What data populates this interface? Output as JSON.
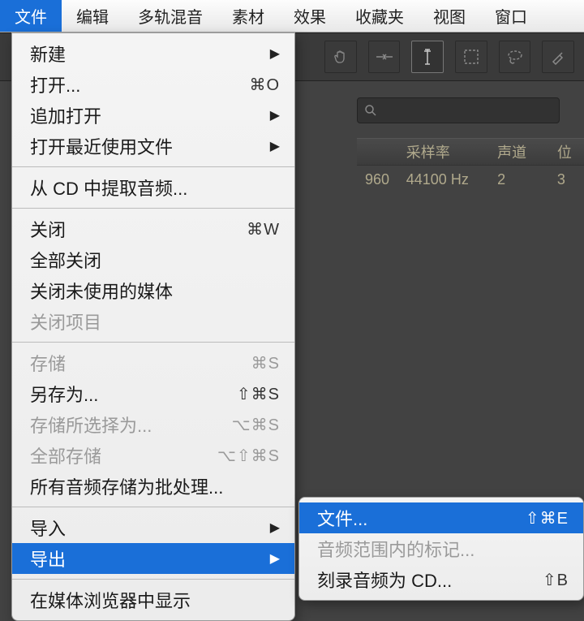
{
  "menubar": {
    "items": [
      {
        "label": "文件",
        "selected": true
      },
      {
        "label": "编辑"
      },
      {
        "label": "多轨混音"
      },
      {
        "label": "素材"
      },
      {
        "label": "效果"
      },
      {
        "label": "收藏夹"
      },
      {
        "label": "视图"
      },
      {
        "label": "窗口"
      }
    ]
  },
  "file_menu": {
    "groups": [
      [
        {
          "label": "新建",
          "submenu": true
        },
        {
          "label": "打开...",
          "shortcut": "⌘O"
        },
        {
          "label": "追加打开",
          "submenu": true
        },
        {
          "label": "打开最近使用文件",
          "submenu": true
        }
      ],
      [
        {
          "label": "从 CD 中提取音频..."
        }
      ],
      [
        {
          "label": "关闭",
          "shortcut": "⌘W"
        },
        {
          "label": "全部关闭"
        },
        {
          "label": "关闭未使用的媒体"
        },
        {
          "label": "关闭项目",
          "disabled": true
        }
      ],
      [
        {
          "label": "存储",
          "shortcut": "⌘S",
          "disabled": true
        },
        {
          "label": "另存为...",
          "shortcut": "⇧⌘S"
        },
        {
          "label": "存储所选择为...",
          "shortcut": "⌥⌘S",
          "disabled": true
        },
        {
          "label": "全部存储",
          "shortcut": "⌥⇧⌘S",
          "disabled": true
        },
        {
          "label": "所有音频存储为批处理..."
        }
      ],
      [
        {
          "label": "导入",
          "submenu": true
        },
        {
          "label": "导出",
          "submenu": true,
          "highlight": true
        }
      ],
      [
        {
          "label": "在媒体浏览器中显示"
        }
      ]
    ]
  },
  "export_submenu": {
    "items": [
      {
        "label": "文件...",
        "shortcut": "⇧⌘E",
        "highlight": true
      },
      {
        "label": "音频范围内的标记...",
        "disabled": true
      },
      {
        "label": "刻录音频为 CD...",
        "shortcut": "⇧B"
      }
    ]
  },
  "toolbar": {
    "tools": [
      {
        "name": "hand-tool"
      },
      {
        "name": "razor-tool"
      },
      {
        "name": "range-tool"
      },
      {
        "name": "ibeam-tool",
        "active": true
      },
      {
        "name": "marquee-tool"
      },
      {
        "name": "lasso-tool"
      },
      {
        "name": "brush-tool"
      }
    ]
  },
  "panel": {
    "search_placeholder": "",
    "columns": {
      "rate": "采样率",
      "channels": "声道",
      "bits": "位"
    },
    "row": {
      "num": "960",
      "rate": "44100 Hz",
      "channels": "2",
      "bits": "3"
    }
  }
}
